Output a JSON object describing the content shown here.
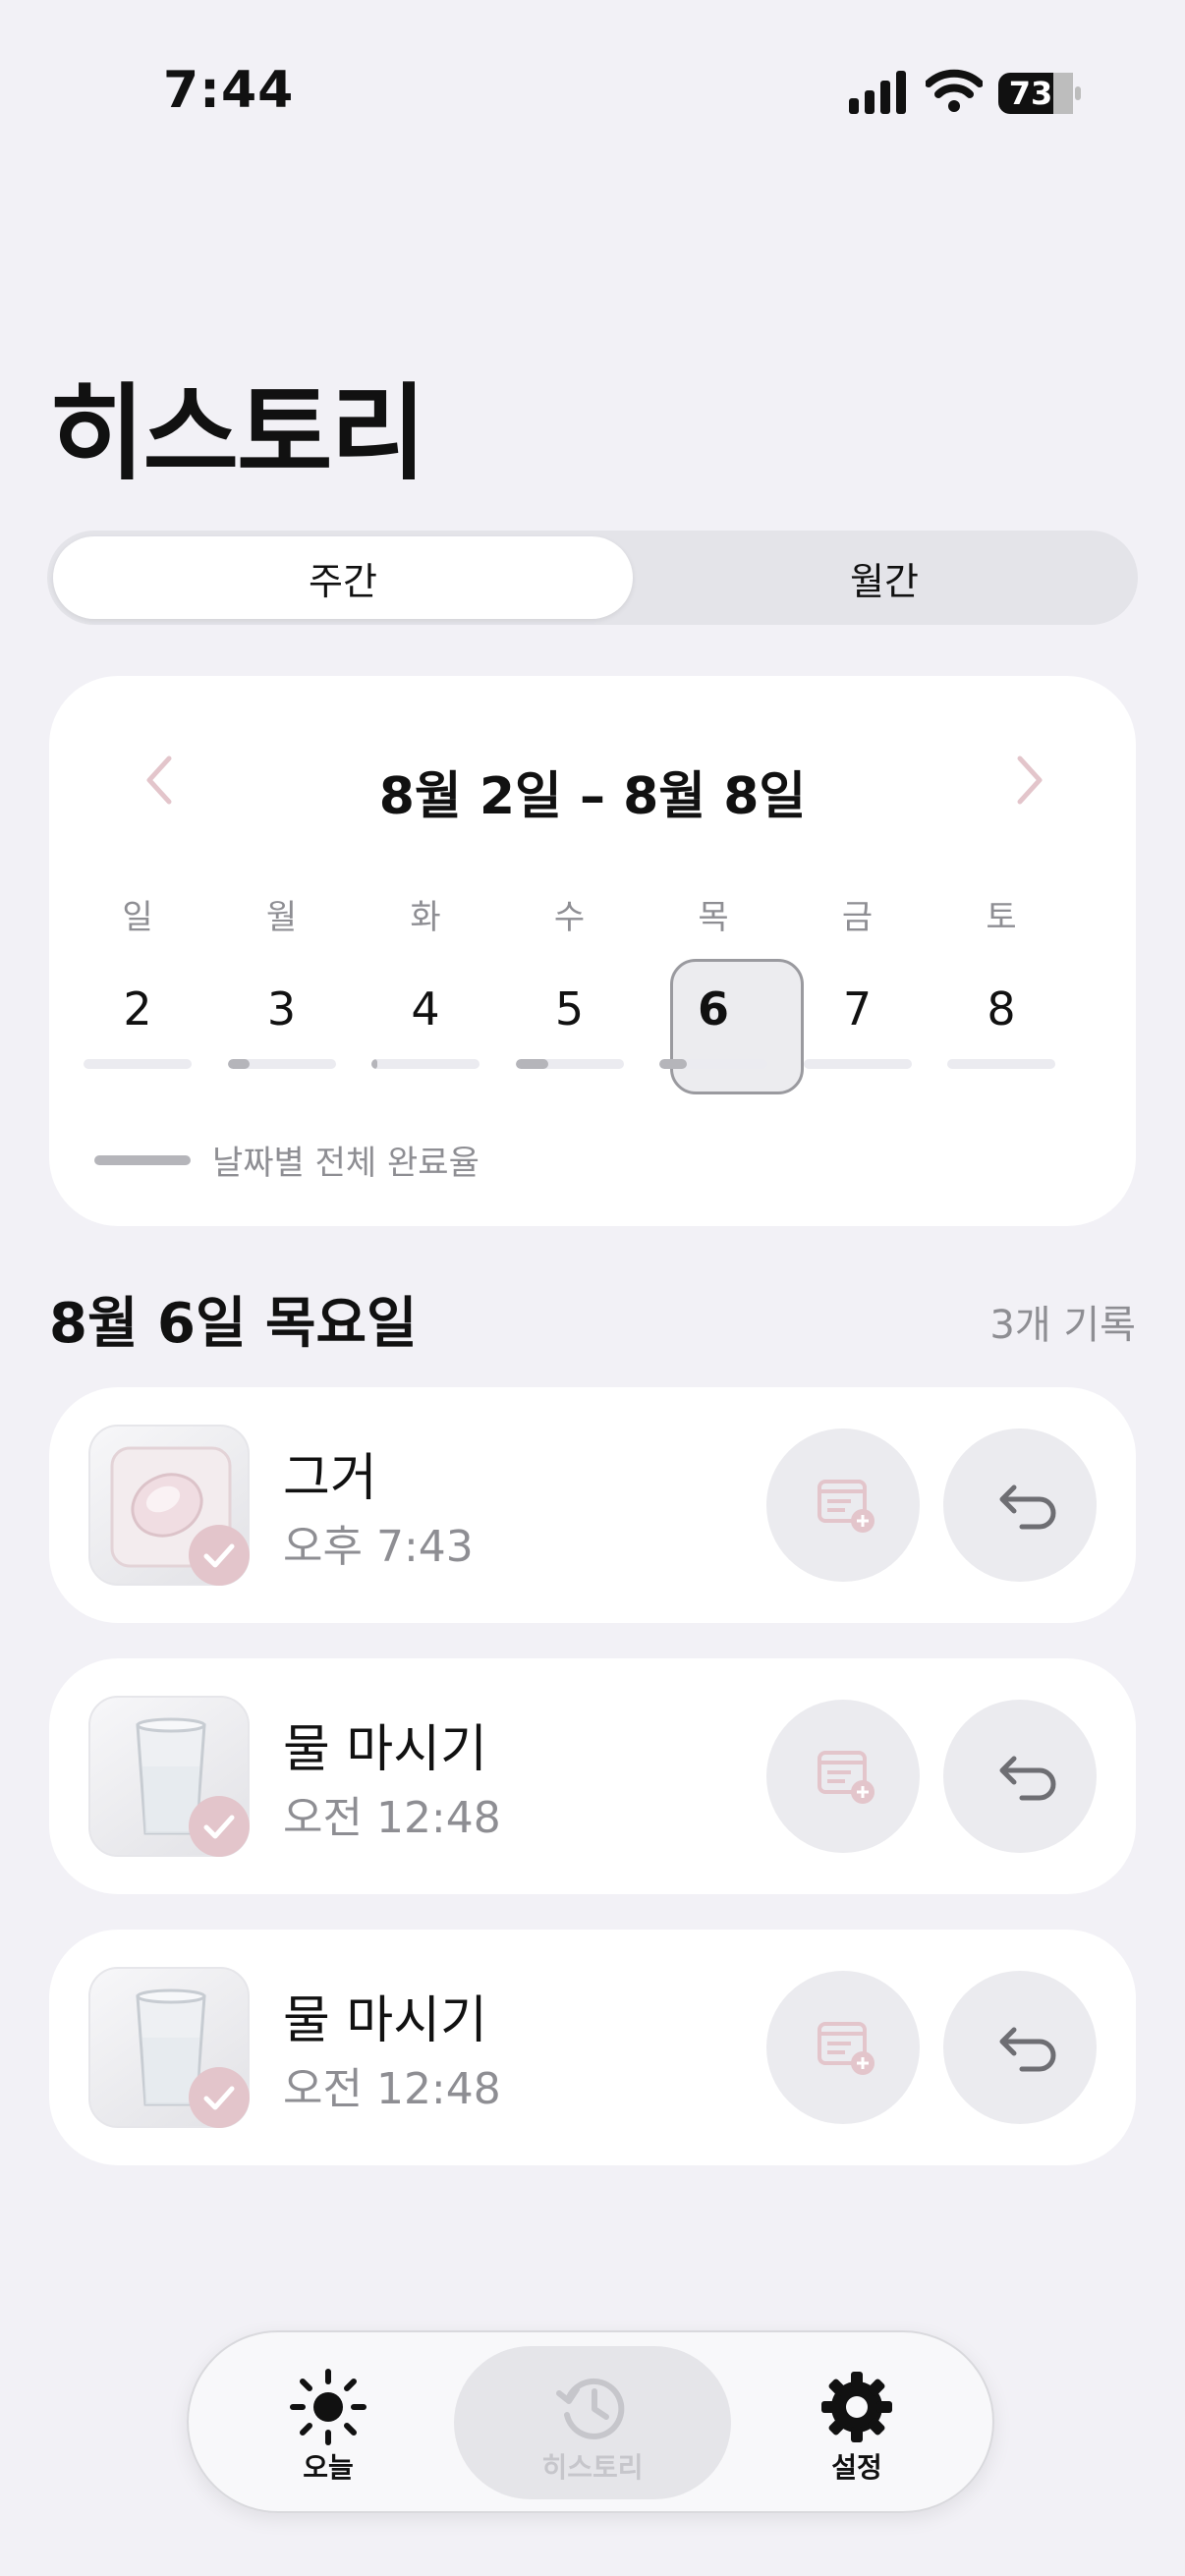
{
  "status_bar": {
    "time": "7:44",
    "battery": "73"
  },
  "page_title": "히스토리",
  "segmented": {
    "options": [
      "주간",
      "월간"
    ],
    "selected": "주간"
  },
  "calendar": {
    "range_label": "8월 2일 – 8월 8일",
    "weekdays": [
      "일",
      "월",
      "화",
      "수",
      "목",
      "금",
      "토"
    ],
    "dates": [
      "2",
      "3",
      "4",
      "5",
      "6",
      "7",
      "8"
    ],
    "completion": [
      0,
      0.2,
      0.05,
      0.3,
      0.25,
      0,
      0
    ],
    "selected_date": "6",
    "legend": "날짜별 전체 완료율"
  },
  "section": {
    "title": "8월 6일 목요일",
    "count": "3개 기록"
  },
  "records": [
    {
      "name": "그거",
      "time": "오후 7:43",
      "thumb": "pill-blister-icon"
    },
    {
      "name": "물 마시기",
      "time": "오전 12:48",
      "thumb": "water-glass-icon"
    },
    {
      "name": "물 마시기",
      "time": "오전 12:48",
      "thumb": "water-glass-icon"
    }
  ],
  "tabbar": {
    "items": [
      {
        "label": "오늘",
        "icon": "sun-icon"
      },
      {
        "label": "히스토리",
        "icon": "history-clock-icon"
      },
      {
        "label": "설정",
        "icon": "gear-icon"
      }
    ],
    "active": "히스토리"
  },
  "colors": {
    "accent_check": "#e3c5cb",
    "chevron": "#e3c5cb",
    "background": "#f2f1f6"
  }
}
